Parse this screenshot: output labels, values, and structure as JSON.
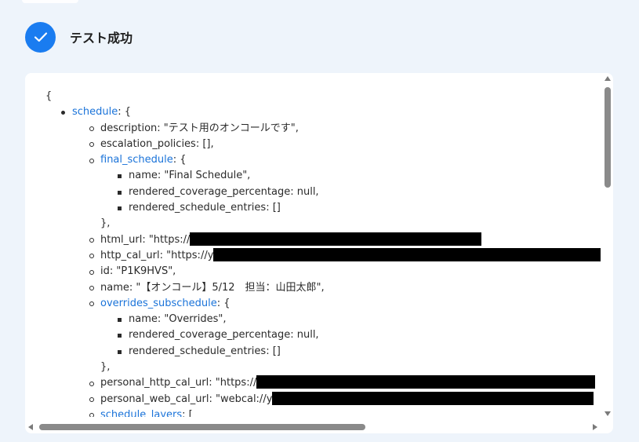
{
  "header": {
    "title": "テスト成功",
    "icon": "check-icon",
    "accent": "#1a7cf0"
  },
  "json_view": {
    "lines": [
      {
        "depth": 0,
        "text": "{"
      },
      {
        "depth": 1,
        "key": "schedule",
        "link": true,
        "rest": ": {"
      },
      {
        "depth": 2,
        "key": "description",
        "rest": ": \"テスト用のオンコールです\","
      },
      {
        "depth": 2,
        "key": "escalation_policies",
        "rest": ": [],"
      },
      {
        "depth": 2,
        "key": "final_schedule",
        "link": true,
        "rest": ": {"
      },
      {
        "depth": 3,
        "key": "name",
        "rest": ": \"Final Schedule\","
      },
      {
        "depth": 3,
        "key": "rendered_coverage_percentage",
        "rest": ": null,"
      },
      {
        "depth": 3,
        "key": "rendered_schedule_entries",
        "rest": ": []"
      },
      {
        "depth": 2,
        "closing": true,
        "text": "},"
      },
      {
        "depth": 2,
        "key": "html_url",
        "rest": ": \"https://",
        "redact": 372
      },
      {
        "depth": 2,
        "key": "http_cal_url",
        "rest": ": \"https://y",
        "redact": 494
      },
      {
        "depth": 2,
        "key": "id",
        "rest": ": \"P1K9HVS\","
      },
      {
        "depth": 2,
        "key": "name",
        "rest": ": \"【オンコール】5/12　担当：山田太郎\","
      },
      {
        "depth": 2,
        "key": "overrides_subschedule",
        "link": true,
        "rest": ": {"
      },
      {
        "depth": 3,
        "key": "name",
        "rest": ": \"Overrides\","
      },
      {
        "depth": 3,
        "key": "rendered_coverage_percentage",
        "rest": ": null,"
      },
      {
        "depth": 3,
        "key": "rendered_schedule_entries",
        "rest": ": []"
      },
      {
        "depth": 2,
        "closing": true,
        "text": "},"
      },
      {
        "depth": 2,
        "key": "personal_http_cal_url",
        "rest": ": \"https://",
        "redact": 432
      },
      {
        "depth": 2,
        "key": "personal_web_cal_url",
        "rest": ": \"webcal://y",
        "redact": 410
      },
      {
        "depth": 2,
        "key": "schedule_layers",
        "link": true,
        "rest": ": ["
      }
    ],
    "colors": {
      "link": "#1a73d9",
      "text": "#2a2a2a",
      "redaction": "#000000"
    }
  }
}
